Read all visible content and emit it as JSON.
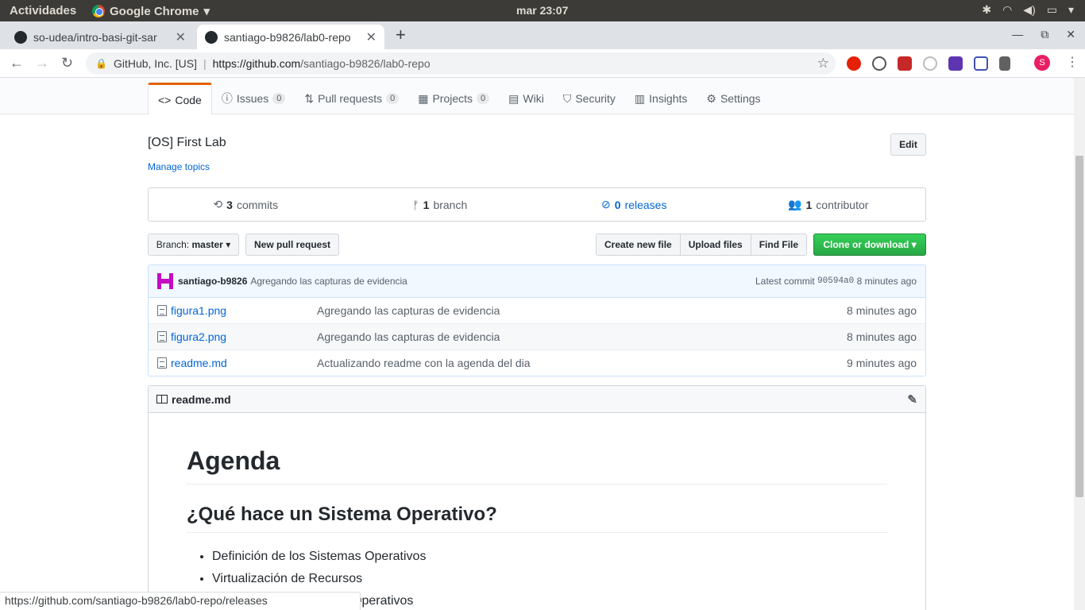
{
  "os": {
    "activities": "Actividades",
    "app": "Google Chrome",
    "clock": "mar 23:07"
  },
  "tabs": [
    {
      "title": "so-udea/intro-basi-git-sar"
    },
    {
      "title": "santiago-b9826/lab0-repo"
    }
  ],
  "omnibox": {
    "org": "GitHub, Inc. [US]",
    "url_host": "https://github.com",
    "url_path": "/santiago-b9826/lab0-repo"
  },
  "ext_colors": [
    "#e52207",
    "#555555",
    "#c62828",
    "#bdbdbd",
    "#5e35b1",
    "#3f51b5",
    "#616161"
  ],
  "profile_initial": "S",
  "repo_tabs": [
    {
      "label": "Code",
      "icon": "<>"
    },
    {
      "label": "Issues",
      "count": "0",
      "icon": "ⓘ"
    },
    {
      "label": "Pull requests",
      "count": "0",
      "icon": "⇅"
    },
    {
      "label": "Projects",
      "count": "0",
      "icon": "▦"
    },
    {
      "label": "Wiki",
      "icon": "▤"
    },
    {
      "label": "Security",
      "icon": "⛉"
    },
    {
      "label": "Insights",
      "icon": "▥"
    },
    {
      "label": "Settings",
      "icon": "⚙"
    }
  ],
  "description": "[OS] First Lab",
  "manage_topics": "Manage topics",
  "edit": "Edit",
  "summary": {
    "commits_n": "3",
    "commits_l": "commits",
    "branch_n": "1",
    "branch_l": "branch",
    "releases_n": "0",
    "releases_l": "releases",
    "contrib_n": "1",
    "contrib_l": "contributor"
  },
  "branch": {
    "prefix": "Branch:",
    "name": "master"
  },
  "new_pr": "New pull request",
  "actions": {
    "create": "Create new file",
    "upload": "Upload files",
    "find": "Find File",
    "clone": "Clone or download"
  },
  "commit": {
    "author": "santiago-b9826",
    "message": "Agregando las capturas de evidencia",
    "latest": "Latest commit",
    "sha": "90594a0",
    "age": "8 minutes ago"
  },
  "files": [
    {
      "name": "figura1.png",
      "msg": "Agregando las capturas de evidencia",
      "age": "8 minutes ago"
    },
    {
      "name": "figura2.png",
      "msg": "Agregando las capturas de evidencia",
      "age": "8 minutes ago"
    },
    {
      "name": "readme.md",
      "msg": "Actualizando readme con la agenda del dia",
      "age": "9 minutes ago"
    }
  ],
  "readme": {
    "file": "readme.md",
    "h1": "Agenda",
    "h2": "¿Qué hace un Sistema Operativo?",
    "items": [
      "Definición de los Sistemas Operativos",
      "Virtualización de Recursos",
      "Historia de los Sistemas Operativos"
    ]
  },
  "status_url": "https://github.com/santiago-b9826/lab0-repo/releases"
}
